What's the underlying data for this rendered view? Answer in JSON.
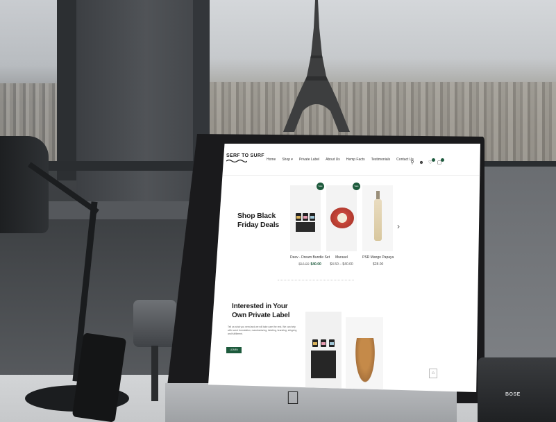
{
  "site": {
    "logo": "SERF TO SURF",
    "menu": [
      "Home",
      "Shop",
      "Private Label",
      "About Us",
      "Hemp Facts",
      "Testimonials",
      "Contact Us"
    ]
  },
  "icons": {
    "search": "search-icon",
    "account": "user-icon",
    "wishlist": "heart-icon",
    "cart": "cart-icon",
    "next": "chevron-right-icon",
    "scroll_top": "arrow-up-icon",
    "brand": "apple-logo-icon"
  },
  "promo": {
    "title": "Shop Black Friday Deals"
  },
  "products": [
    {
      "name": "Deev - Dream Bundle Set",
      "old_price": "$54.99",
      "price": "$40.00",
      "badge": "Sale"
    },
    {
      "name": "Murasel",
      "price": "$4.50 – $40.00",
      "badge": "Sale"
    },
    {
      "name": "PSR Mango Papaya",
      "price": "$28.00"
    }
  ],
  "private_label": {
    "title": "Interested in Your Own Private Label",
    "body": "Tell us what you need and we will take care the rest. We can help with scent formulation, manufacturing, labeling, branding, shipping and fulfillment.",
    "button": "LEARN MORE"
  },
  "speaker_brand": "BOSE",
  "colors": {
    "accent": "#1d5a3c",
    "text": "#1e1e1e"
  }
}
